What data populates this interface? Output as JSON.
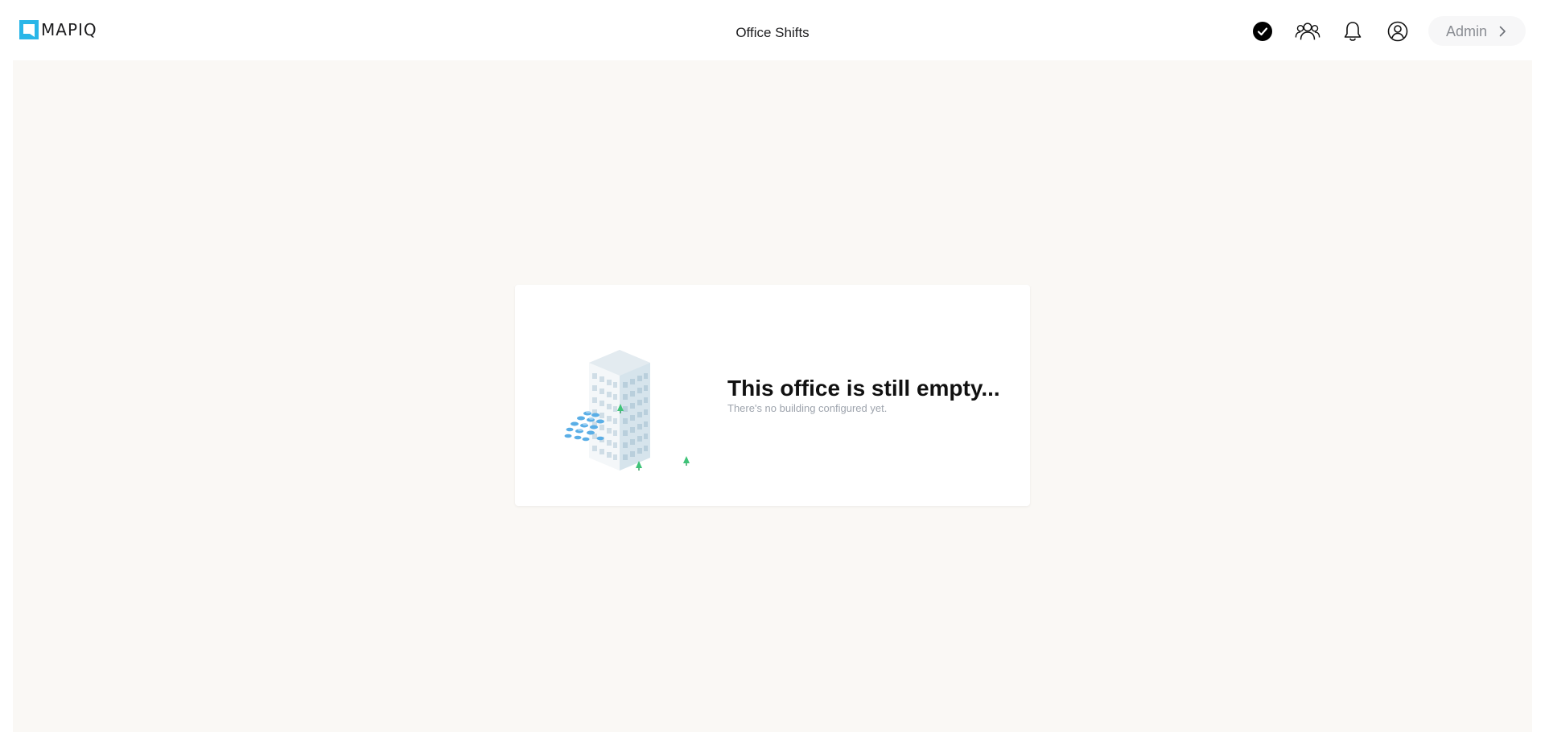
{
  "header": {
    "logo_text": "MAPIQ",
    "title": "Office Shifts",
    "icons": [
      "check-circle-icon",
      "people-icon",
      "bell-icon",
      "user-circle-icon"
    ],
    "admin_label": "Admin"
  },
  "main": {
    "empty_state": {
      "title": "This office is still empty...",
      "subtitle": "There's no building configured yet."
    }
  },
  "colors": {
    "brand": "#29b6e8",
    "background": "#faf8f5",
    "text_primary": "#111111",
    "text_muted": "#9ea4ad"
  }
}
